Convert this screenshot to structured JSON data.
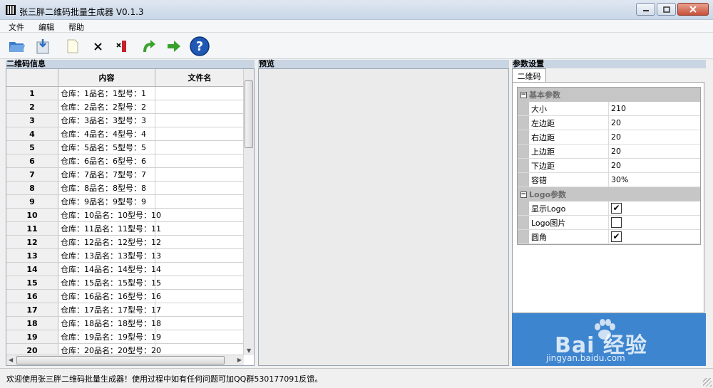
{
  "window": {
    "title": "张三胖二维码批量生成器 V0.1.3",
    "controls": [
      "minimize",
      "maximize",
      "close"
    ]
  },
  "menu": [
    "文件",
    "编辑",
    "帮助"
  ],
  "toolbar": {
    "icons": [
      "open-folder-icon",
      "import-icon",
      "new-file-icon",
      "delete-icon",
      "delete-column-icon",
      "redo-icon",
      "forward-arrow-icon",
      "help-icon"
    ]
  },
  "left_panel": {
    "header": "二维码信息",
    "columns": [
      "",
      "内容",
      "文件名"
    ],
    "rows": [
      {
        "num": "1",
        "content": "仓库：1品名：1型号：1",
        "filename": ""
      },
      {
        "num": "2",
        "content": "仓库：2品名：2型号：2",
        "filename": ""
      },
      {
        "num": "3",
        "content": "仓库：3品名：3型号：3",
        "filename": ""
      },
      {
        "num": "4",
        "content": "仓库：4品名：4型号：4",
        "filename": ""
      },
      {
        "num": "5",
        "content": "仓库：5品名：5型号：5",
        "filename": ""
      },
      {
        "num": "6",
        "content": "仓库：6品名：6型号：6",
        "filename": ""
      },
      {
        "num": "7",
        "content": "仓库：7品名：7型号：7",
        "filename": ""
      },
      {
        "num": "8",
        "content": "仓库：8品名：8型号：8",
        "filename": ""
      },
      {
        "num": "9",
        "content": "仓库：9品名：9型号：9",
        "filename": ""
      },
      {
        "num": "10",
        "content": "仓库：10品名：10型号：10",
        "filename": ""
      },
      {
        "num": "11",
        "content": "仓库：11品名：11型号：11",
        "filename": ""
      },
      {
        "num": "12",
        "content": "仓库：12品名：12型号：12",
        "filename": ""
      },
      {
        "num": "13",
        "content": "仓库：13品名：13型号：13",
        "filename": ""
      },
      {
        "num": "14",
        "content": "仓库：14品名：14型号：14",
        "filename": ""
      },
      {
        "num": "15",
        "content": "仓库：15品名：15型号：15",
        "filename": ""
      },
      {
        "num": "16",
        "content": "仓库：16品名：16型号：16",
        "filename": ""
      },
      {
        "num": "17",
        "content": "仓库：17品名：17型号：17",
        "filename": ""
      },
      {
        "num": "18",
        "content": "仓库：18品名：18型号：18",
        "filename": ""
      },
      {
        "num": "19",
        "content": "仓库：19品名：19型号：19",
        "filename": ""
      },
      {
        "num": "20",
        "content": "仓库：20品名：20型号：20",
        "filename": ""
      }
    ]
  },
  "preview_panel": {
    "header": "预览"
  },
  "right_panel": {
    "header": "参数设置",
    "tab": "二维码",
    "categories": [
      {
        "name": "基本参数",
        "toggle": "⊟",
        "props": [
          {
            "name": "大小",
            "value": "210"
          },
          {
            "name": "左边距",
            "value": "20"
          },
          {
            "name": "右边距",
            "value": "20"
          },
          {
            "name": "上边距",
            "value": "20"
          },
          {
            "name": "下边距",
            "value": "20"
          },
          {
            "name": "容错",
            "value": "30%"
          }
        ]
      },
      {
        "name": "Logo参数",
        "toggle": "⊟",
        "props": [
          {
            "name": "显示Logo",
            "checked": true
          },
          {
            "name": "Logo图片",
            "checked": false
          },
          {
            "name": "圆角",
            "checked": true
          }
        ]
      }
    ]
  },
  "watermark": {
    "text": "Bai 经验",
    "url": "jingyan.baidu.com"
  },
  "status": "欢迎使用张三胖二维码批量生成器！使用过程中如有任何问题可加QQ群530177091反馈。",
  "colors": {
    "titlebar": "#c9d7e8",
    "panel_header": "#c9d5e3",
    "category_bg": "#c6c6c6",
    "watermark_blue": "#3e85d0"
  }
}
